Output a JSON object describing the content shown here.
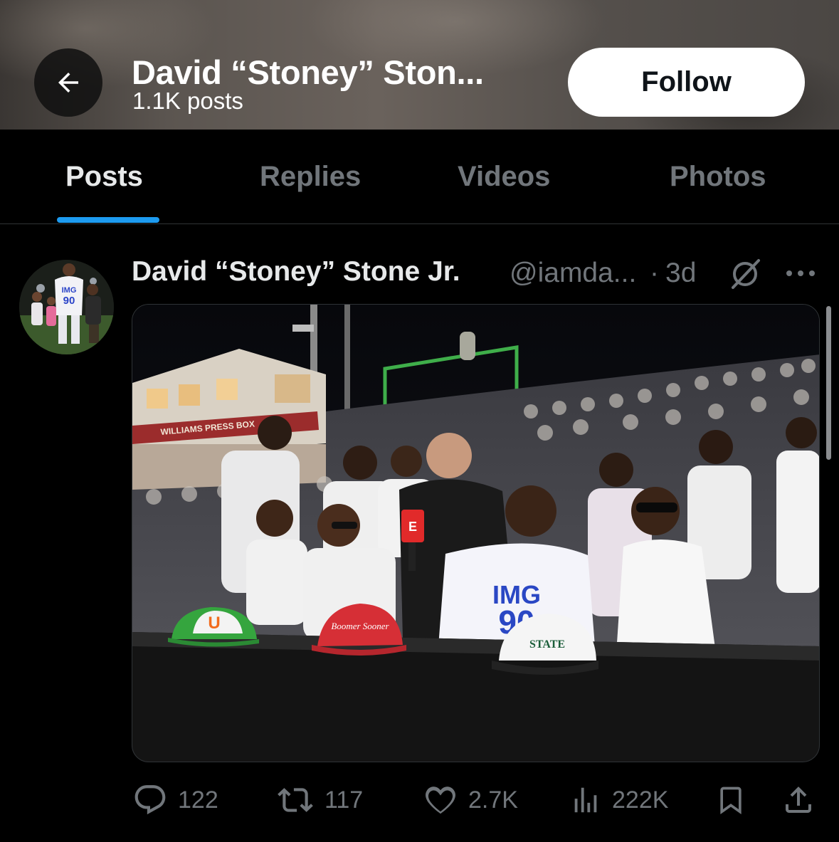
{
  "header": {
    "title": "David “Stoney” Ston...",
    "posts_count": "1.1K posts",
    "follow_label": "Follow"
  },
  "tabs": [
    {
      "label": "Posts",
      "active": true
    },
    {
      "label": "Replies",
      "active": false
    },
    {
      "label": "Videos",
      "active": false
    },
    {
      "label": "Photos",
      "active": false
    }
  ],
  "post": {
    "author": "David “Stoney” Stone Jr.",
    "handle": "@iamda...",
    "separator": "·",
    "time": "3d",
    "avatar_jersey": "IMG 90",
    "media": {
      "banner_text": "WILLIAMS PRESS BOX",
      "mic_flag": "E",
      "jersey_text": "IMG",
      "jersey_number": "90",
      "hat_left_text": "U",
      "hat_middle_text": "Boomer Sooner",
      "hat_right_text": "STATE"
    },
    "actions": {
      "replies": "122",
      "reposts": "117",
      "likes": "2.7K",
      "views": "222K"
    }
  },
  "colors": {
    "accent": "#1d9bf0",
    "muted": "#71767b",
    "text": "#e7e9ea",
    "background": "#000000"
  },
  "icons": [
    "back-arrow-icon",
    "grok-icon",
    "more-icon",
    "reply-icon",
    "repost-icon",
    "like-icon",
    "views-icon",
    "bookmark-icon",
    "share-icon"
  ]
}
